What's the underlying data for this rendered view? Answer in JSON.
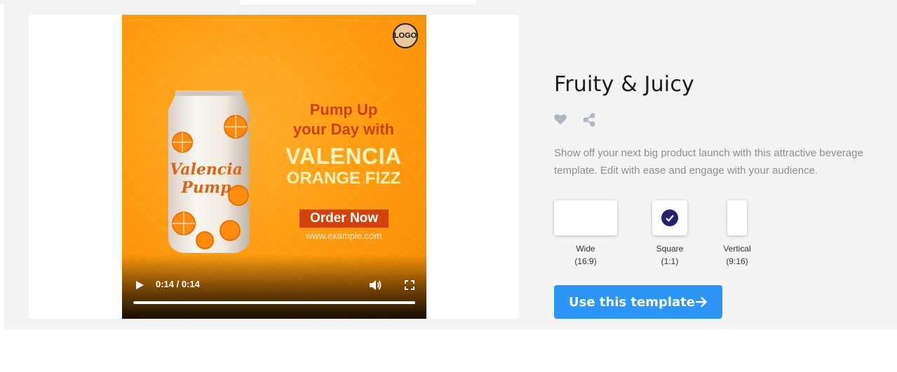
{
  "template": {
    "title": "Fruity & Juicy",
    "description": "Show off your next big product launch with this attractive beverage template. Edit with ease and engage with your audience.",
    "icons": {
      "favorite": "heart-icon",
      "share": "share-icon"
    }
  },
  "preview": {
    "logo_text": "LOGO",
    "can_text_line1": "Valencia",
    "can_text_line2": "Pump",
    "headline_line1": "Pump Up",
    "headline_line2": "your Day with",
    "headline_line3": "VALENCIA",
    "headline_line4": "ORANGE FIZZ",
    "order_button": "Order Now",
    "url": "www.example.com",
    "player": {
      "time": "0:14 / 0:14",
      "progress": 1.0,
      "icons": {
        "play": "play-icon",
        "volume": "volume-icon",
        "fullscreen": "fullscreen-icon"
      }
    }
  },
  "formats": [
    {
      "name": "Wide",
      "ratio": "(16:9)",
      "selected": false
    },
    {
      "name": "Square",
      "ratio": "(1:1)",
      "selected": true
    },
    {
      "name": "Vertical",
      "ratio": "(9:16)",
      "selected": false
    }
  ],
  "cta": {
    "label": "Use this template",
    "icon": "arrow-right-icon"
  },
  "colors": {
    "accent": "#2d95f5",
    "selected_check": "#26226b",
    "video_orange": "#ff9d12",
    "order_button": "#d4410c"
  }
}
